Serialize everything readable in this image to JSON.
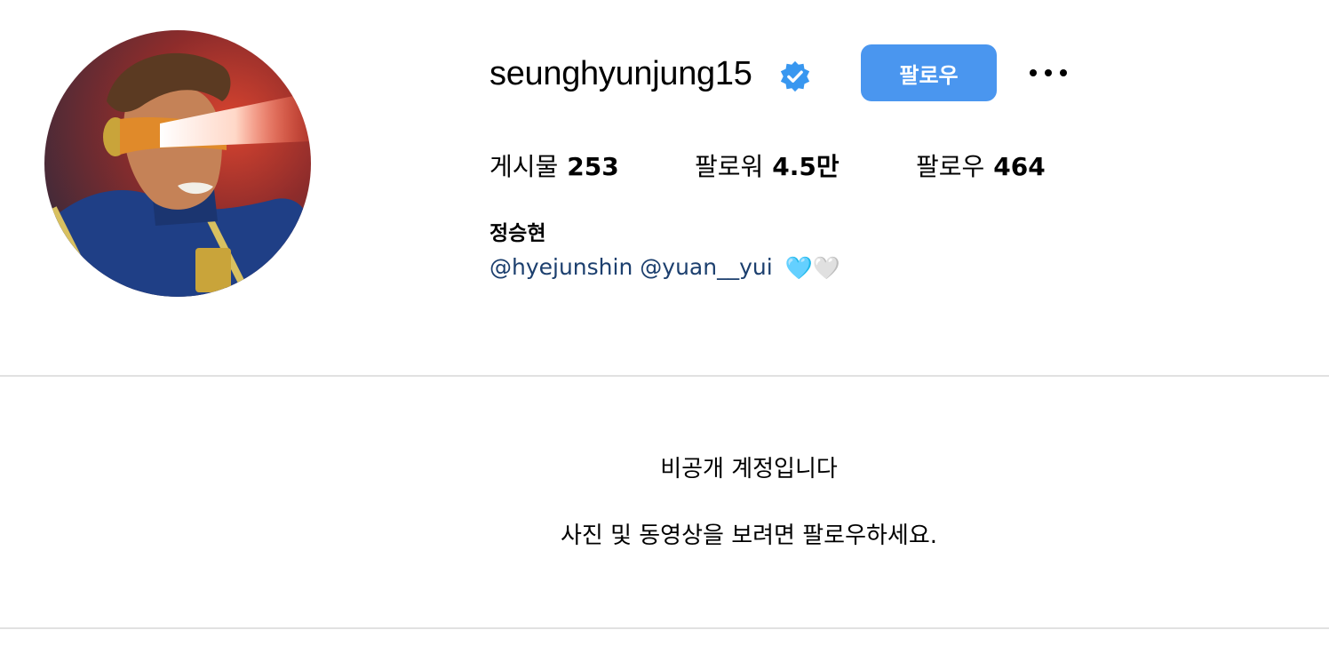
{
  "profile": {
    "username": "seunghyunjung15",
    "verified_icon": "verified-badge-icon",
    "follow_label": "팔로우",
    "more_icon": "more-options-icon",
    "accent_color": "#4a96ef"
  },
  "stats": {
    "posts_label": "게시물",
    "posts_value": "253",
    "followers_label": "팔로워",
    "followers_value": "4.5만",
    "following_label": "팔로우",
    "following_value": "464"
  },
  "bio": {
    "full_name": "정승현",
    "mention_1": "@hyejunshin",
    "mention_2": "@yuan__yui",
    "hearts": "🩵🤍"
  },
  "private": {
    "title": "비공개 계정입니다",
    "subtitle": "사진 및 동영상을 보려면 팔로우하세요."
  }
}
